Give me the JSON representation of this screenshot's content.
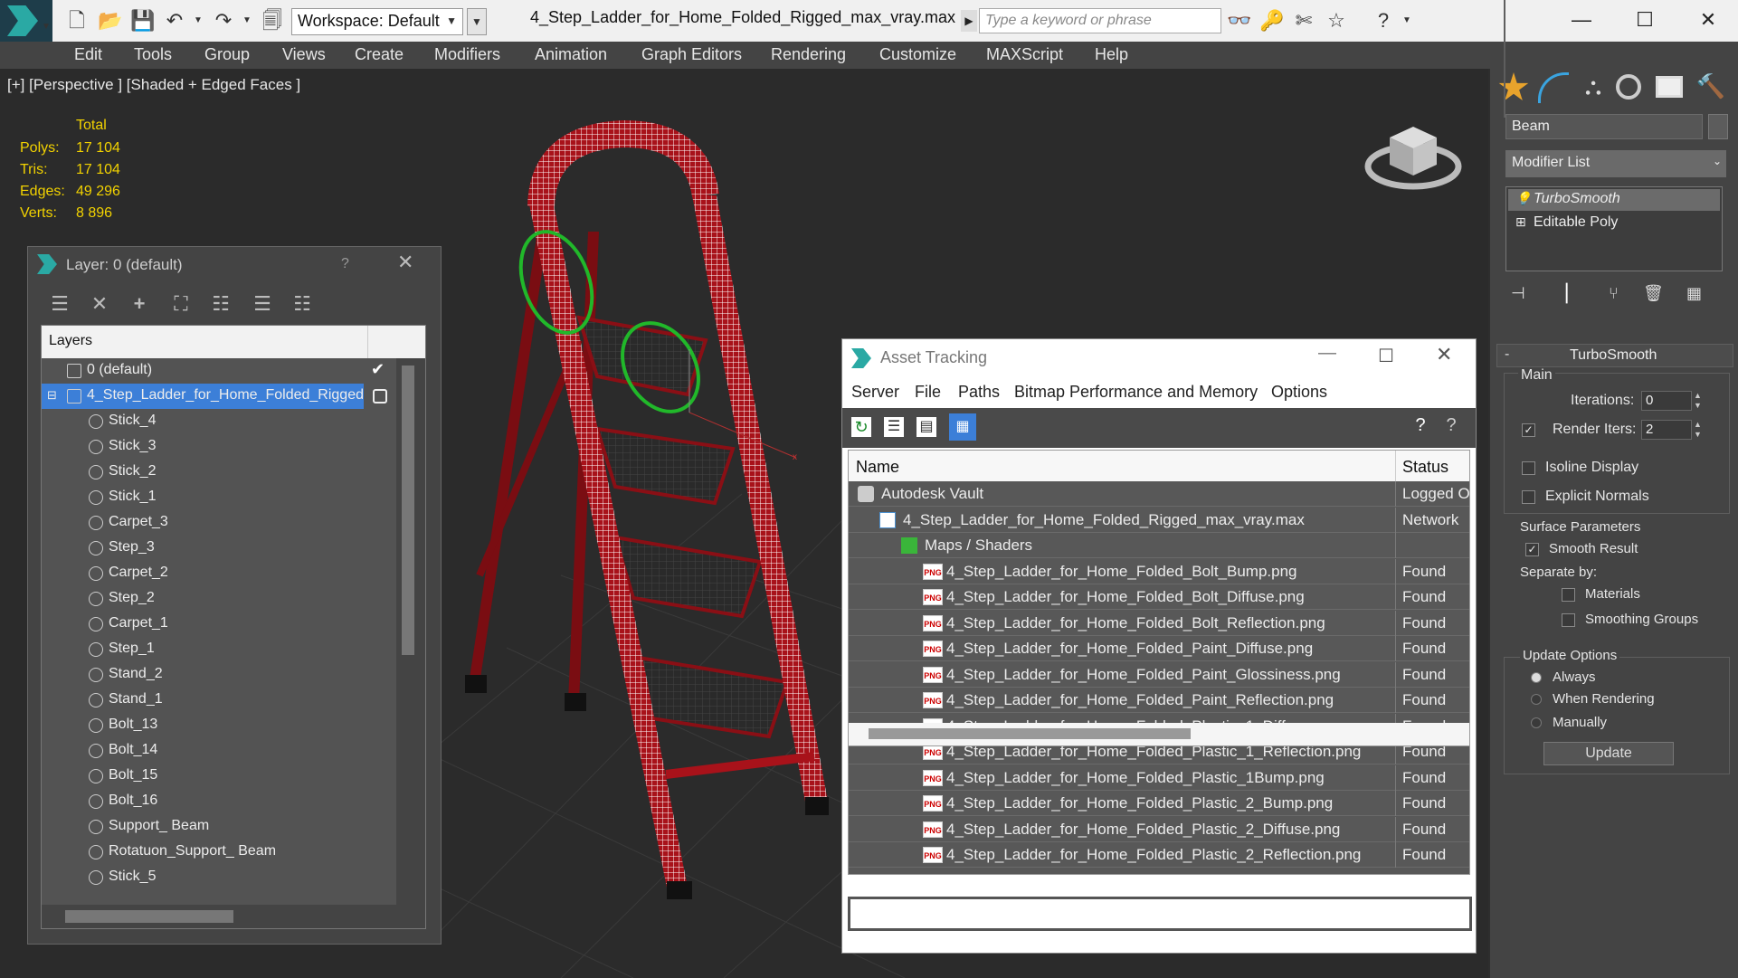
{
  "titlebar": {
    "workspace": "Workspace: Default",
    "file_title": "4_Step_Ladder_for_Home_Folded_Rigged_max_vray.max",
    "search_placeholder": "Type a keyword or phrase"
  },
  "menu": [
    "Edit",
    "Tools",
    "Group",
    "Views",
    "Create",
    "Modifiers",
    "Animation",
    "Graph Editors",
    "Rendering",
    "Customize",
    "MAXScript",
    "Help"
  ],
  "viewport": {
    "label": "[+] [Perspective ] [Shaded + Edged Faces ]",
    "stats_header": "Total",
    "stats": [
      {
        "label": "Polys:",
        "value": "17 104"
      },
      {
        "label": "Tris:",
        "value": "17 104"
      },
      {
        "label": "Edges:",
        "value": "49 296"
      },
      {
        "label": "Verts:",
        "value": "8 896"
      }
    ]
  },
  "command_panel": {
    "object_name": "Beam",
    "modifier_list": "Modifier List",
    "stack": [
      "TurboSmooth",
      "Editable Poly"
    ],
    "rollout_title": "TurboSmooth",
    "main_label": "Main",
    "iterations_label": "Iterations:",
    "iterations_value": "0",
    "render_iters_label": "Render Iters:",
    "render_iters_value": "2",
    "isoline_display": "Isoline Display",
    "explicit_normals": "Explicit Normals",
    "surface_params": "Surface Parameters",
    "smooth_result": "Smooth Result",
    "separate_by": "Separate by:",
    "materials": "Materials",
    "smoothing_groups": "Smoothing Groups",
    "update_options": "Update Options",
    "always": "Always",
    "when_rendering": "When Rendering",
    "manually": "Manually",
    "update_button": "Update"
  },
  "layer_dialog": {
    "title": "Layer: 0 (default)",
    "help": "?",
    "header": "Layers",
    "rows": [
      "0 (default)",
      "4_Step_Ladder_for_Home_Folded_Rigged",
      "Stick_4",
      "Stick_3",
      "Stick_2",
      "Stick_1",
      "Carpet_3",
      "Step_3",
      "Carpet_2",
      "Step_2",
      "Carpet_1",
      "Step_1",
      "Stand_2",
      "Stand_1",
      "Bolt_13",
      "Bolt_14",
      "Bolt_15",
      "Bolt_16",
      "Support_ Beam",
      "Rotatuon_Support_ Beam",
      "Stick_5"
    ]
  },
  "asset_tracking": {
    "title": "Asset Tracking",
    "menu": [
      "Server",
      "File",
      "Paths",
      "Bitmap Performance and Memory",
      "Options"
    ],
    "col_name": "Name",
    "col_status": "Status",
    "rows": [
      {
        "name": "Autodesk Vault",
        "status": "Logged O",
        "indent": 0,
        "kind": "vault"
      },
      {
        "name": "4_Step_Ladder_for_Home_Folded_Rigged_max_vray.max",
        "status": "Network",
        "indent": 1,
        "kind": "max"
      },
      {
        "name": "Maps / Shaders",
        "status": "",
        "indent": 2,
        "kind": "maps"
      },
      {
        "name": "4_Step_Ladder_for_Home_Folded_Bolt_Bump.png",
        "status": "Found",
        "indent": 3,
        "kind": "png"
      },
      {
        "name": "4_Step_Ladder_for_Home_Folded_Bolt_Diffuse.png",
        "status": "Found",
        "indent": 3,
        "kind": "png"
      },
      {
        "name": "4_Step_Ladder_for_Home_Folded_Bolt_Reflection.png",
        "status": "Found",
        "indent": 3,
        "kind": "png"
      },
      {
        "name": "4_Step_Ladder_for_Home_Folded_Paint_Diffuse.png",
        "status": "Found",
        "indent": 3,
        "kind": "png"
      },
      {
        "name": "4_Step_Ladder_for_Home_Folded_Paint_Glossiness.png",
        "status": "Found",
        "indent": 3,
        "kind": "png"
      },
      {
        "name": "4_Step_Ladder_for_Home_Folded_Paint_Reflection.png",
        "status": "Found",
        "indent": 3,
        "kind": "png"
      },
      {
        "name": "4_Step_Ladder_for_Home_Folded_Plastic_1_Diffuse.png",
        "status": "Found",
        "indent": 3,
        "kind": "png"
      },
      {
        "name": "4_Step_Ladder_for_Home_Folded_Plastic_1_Reflection.png",
        "status": "Found",
        "indent": 3,
        "kind": "png"
      },
      {
        "name": "4_Step_Ladder_for_Home_Folded_Plastic_1Bump.png",
        "status": "Found",
        "indent": 3,
        "kind": "png"
      },
      {
        "name": "4_Step_Ladder_for_Home_Folded_Plastic_2_Bump.png",
        "status": "Found",
        "indent": 3,
        "kind": "png"
      },
      {
        "name": "4_Step_Ladder_for_Home_Folded_Plastic_2_Diffuse.png",
        "status": "Found",
        "indent": 3,
        "kind": "png"
      },
      {
        "name": "4_Step_Ladder_for_Home_Folded_Plastic_2_Reflection.png",
        "status": "Found",
        "indent": 3,
        "kind": "png"
      }
    ]
  },
  "colors": {
    "selection": "#3c7fd8",
    "stat_yellow": "#f2d200",
    "ladder_red": "#b0141c"
  }
}
